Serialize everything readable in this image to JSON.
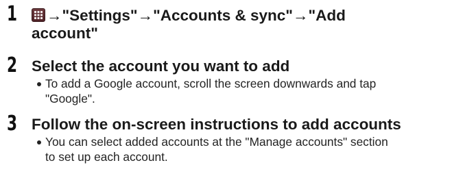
{
  "steps": [
    {
      "number": "1",
      "icon": "apps-grid-icon",
      "heading_part": "→\"Settings\"→\"Accounts & sync\"→\"Add",
      "heading_line2": "account\""
    },
    {
      "number": "2",
      "heading": "Select the account you want to add",
      "bullet_line1": "To add a Google account, scroll the screen downwards and tap",
      "bullet_line2": "\"Google\"."
    },
    {
      "number": "3",
      "heading": "Follow the on-screen instructions to add accounts",
      "bullet_line1": "You can select added accounts at the \"Manage accounts\" section",
      "bullet_line2": "to set up each account."
    }
  ]
}
